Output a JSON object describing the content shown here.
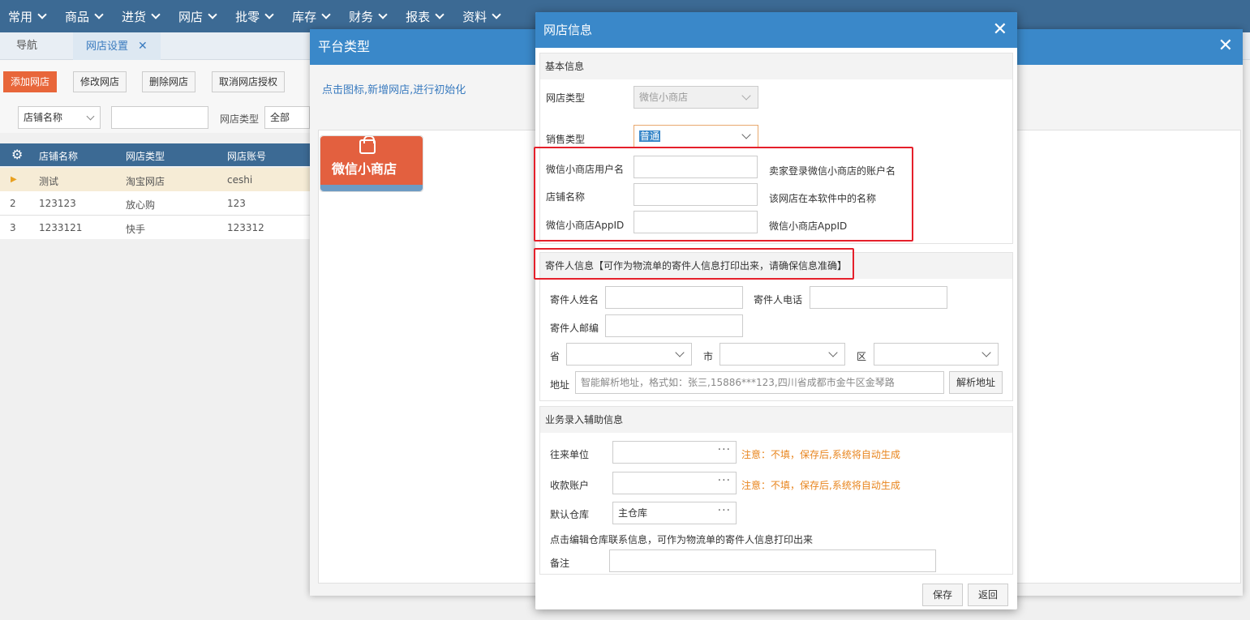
{
  "topmenu": [
    "常用",
    "商品",
    "进货",
    "网店",
    "批零",
    "库存",
    "财务",
    "报表",
    "资料"
  ],
  "tabs": {
    "nav": "导航",
    "active": "网店设置"
  },
  "toolbar": {
    "add": "添加网店",
    "edit": "修改网店",
    "delete": "删除网店",
    "revoke": "取消网店授权"
  },
  "filter": {
    "field_select": "店铺名称",
    "type_label": "网店类型",
    "type_value": "全部"
  },
  "grid": {
    "columns": [
      "店铺名称",
      "网店类型",
      "网店账号"
    ],
    "rows": [
      {
        "marker": "▶",
        "name": "测试",
        "type": "淘宝网店",
        "account": "ceshi"
      },
      {
        "marker": "2",
        "name": "123123",
        "type": "放心购",
        "account": "123"
      },
      {
        "marker": "3",
        "name": "1233121",
        "type": "快手",
        "account": "123312"
      }
    ]
  },
  "platform_dialog": {
    "title": "平台类型",
    "hint": "点击图标,新增网店,进行初始化",
    "tile_label": "微信小商店"
  },
  "dialog": {
    "title": "网店信息",
    "basic": {
      "header": "基本信息",
      "shop_type_label": "网店类型",
      "shop_type_value": "微信小商店",
      "sale_type_label": "销售类型",
      "sale_type_value": "普通",
      "username_label": "微信小商店用户名",
      "username_hint": "卖家登录微信小商店的账户名",
      "shopname_label": "店铺名称",
      "shopname_hint": "该网店在本软件中的名称",
      "appid_label": "微信小商店AppID",
      "appid_hint": "微信小商店AppID"
    },
    "sender": {
      "header": "寄件人信息【可作为物流单的寄件人信息打印出来，请确保信息准确】",
      "name_label": "寄件人姓名",
      "phone_label": "寄件人电话",
      "zip_label": "寄件人邮编",
      "province_label": "省",
      "city_label": "市",
      "district_label": "区",
      "address_label": "地址",
      "address_placeholder": "智能解析地址，格式如：张三,15886***123,四川省成都市金牛区金琴路",
      "parse_button": "解析地址"
    },
    "business": {
      "header": "业务录入辅助信息",
      "partner_label": "往来单位",
      "partner_note": "注意：不填，保存后,系统将自动生成",
      "account_label": "收款账户",
      "account_note": "注意：不填，保存后,系统将自动生成",
      "warehouse_label": "默认仓库",
      "warehouse_value": "主仓库",
      "warehouse_tip": "点击编辑仓库联系信息，可作为物流单的寄件人信息打印出来",
      "remark_label": "备注"
    },
    "save_button": "保存",
    "back_button": "返回"
  },
  "colors": {
    "header_blue": "#3a88c9",
    "nav_blue": "#3c6a94",
    "accent_orange": "#e8663a",
    "note_orange": "#e8851e",
    "highlight_red": "#e5202b"
  }
}
